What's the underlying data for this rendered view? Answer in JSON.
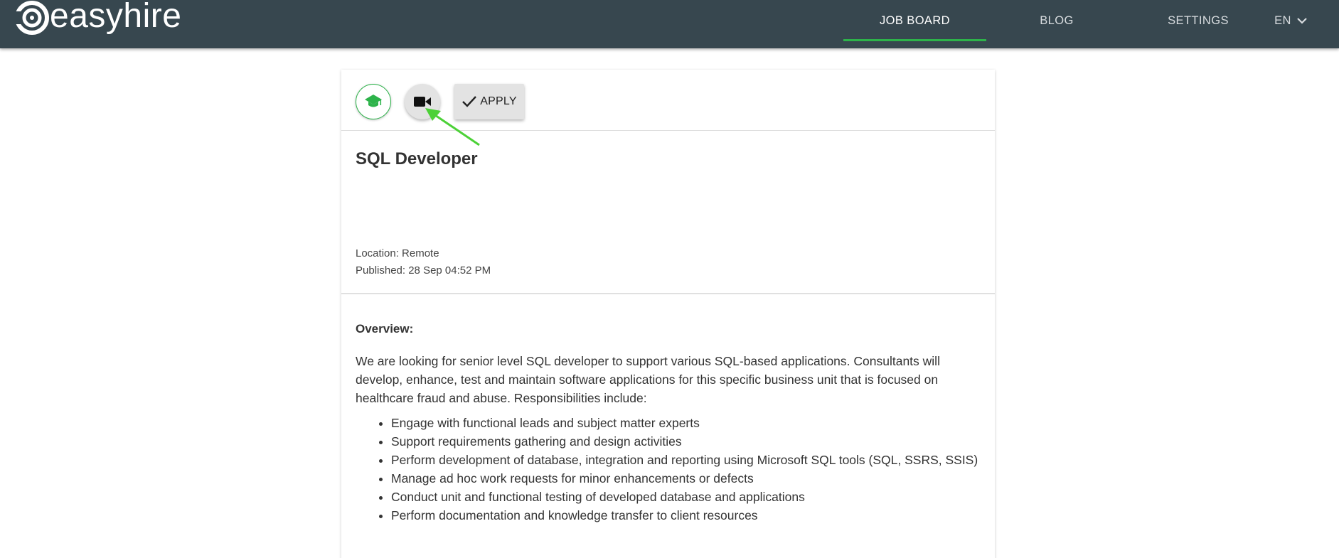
{
  "brand": {
    "name": "easyhire"
  },
  "nav": {
    "items": [
      {
        "label": "JOB BOARD",
        "active": true
      },
      {
        "label": "BLOG",
        "active": false
      },
      {
        "label": "SETTINGS",
        "active": false
      }
    ],
    "language": "EN"
  },
  "actions": {
    "education_icon": "graduation-cap-icon",
    "video_icon": "video-camera-icon",
    "apply_label": "APPLY"
  },
  "job": {
    "title": "SQL Developer",
    "location": "Location: Remote",
    "published": "Published: 28 Sep 04:52 PM",
    "overview_heading": "Overview:",
    "intro": "We are looking for senior level SQL developer to support various SQL-based applications. Consultants will develop, enhance, test and maintain software applications for this specific business unit that is focused on healthcare fraud and abuse. Responsibilities include:",
    "responsibilities": [
      "Engage with functional leads and subject matter experts",
      "Support requirements gathering and design activities",
      "Perform development of database, integration and reporting using Microsoft SQL tools (SQL, SSRS, SSIS)",
      "Manage ad hoc work requests for minor enhancements or defects",
      "Conduct unit and functional testing of developed database and applications",
      "Perform documentation and knowledge transfer to client resources"
    ]
  },
  "colors": {
    "header_bg": "#37474f",
    "accent_green": "#2db34a",
    "annotation_arrow": "#4cd137"
  }
}
